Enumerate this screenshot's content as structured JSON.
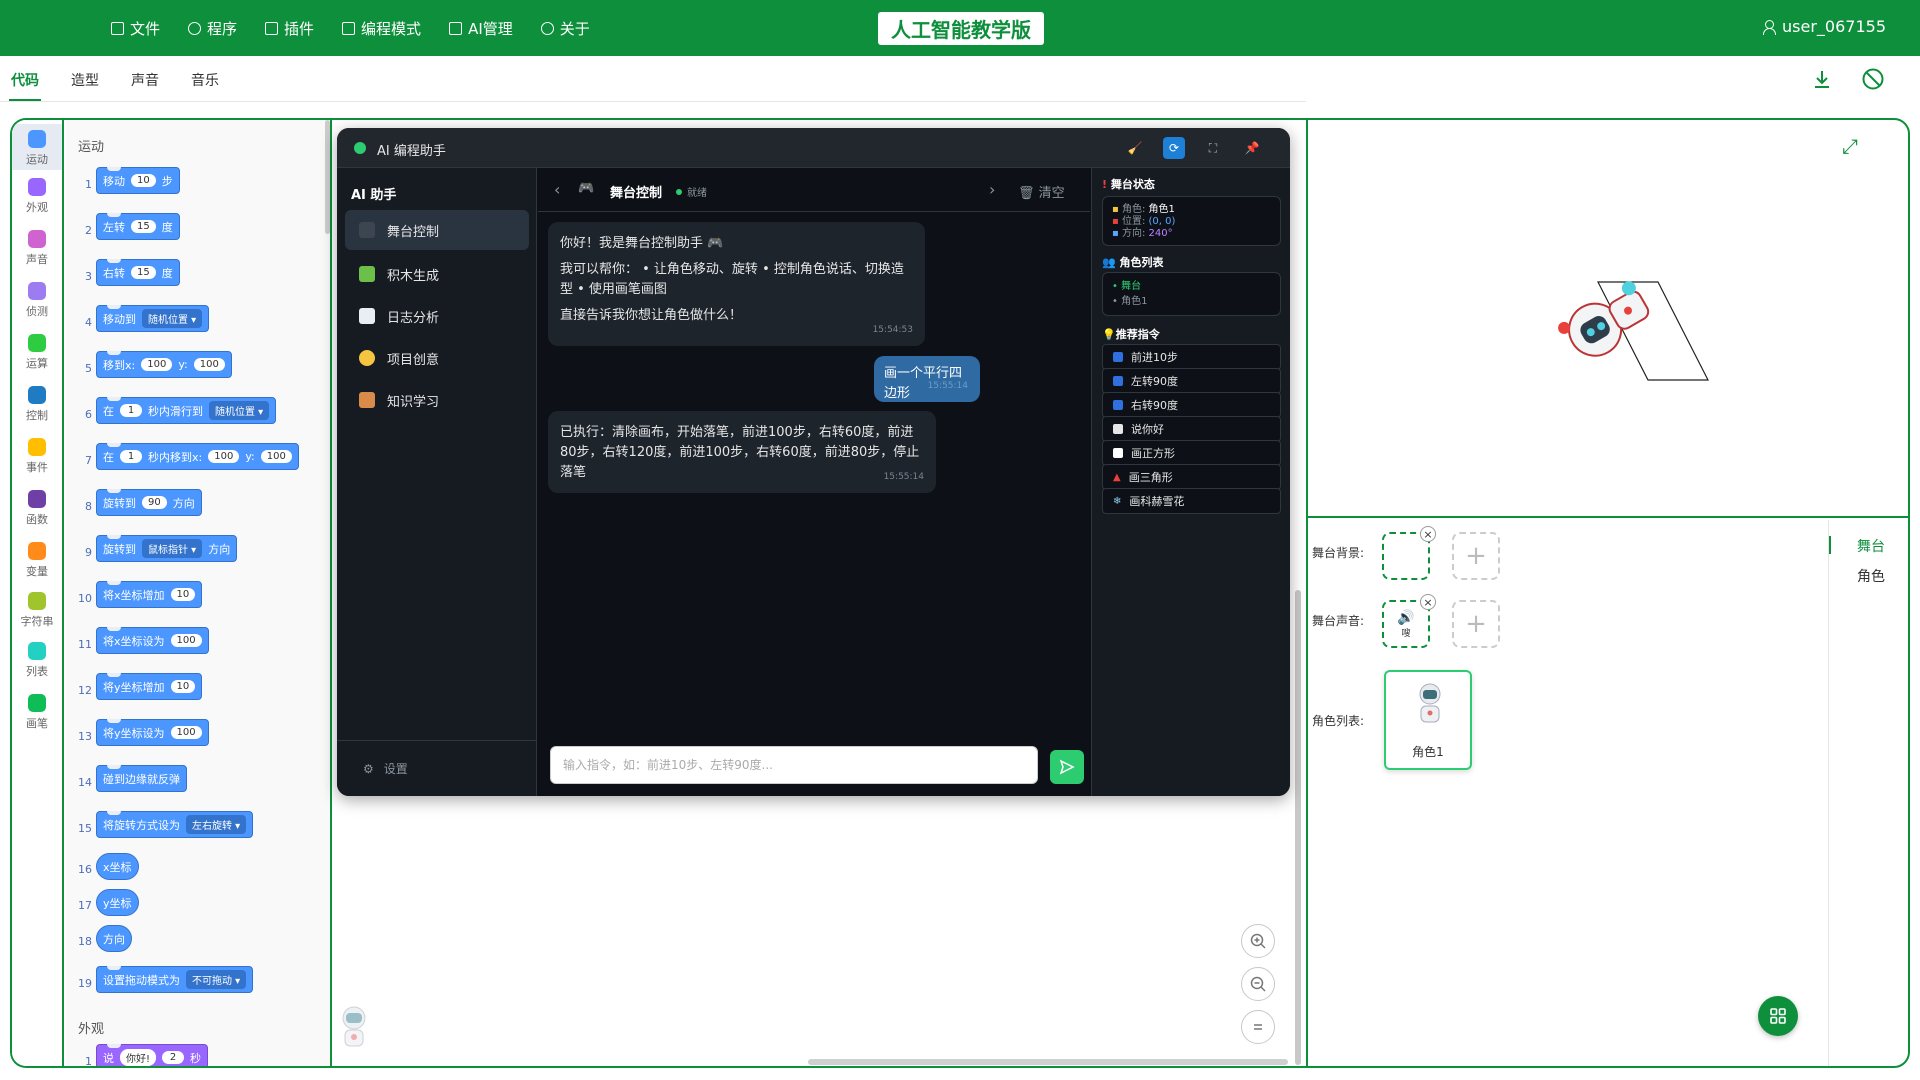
{
  "menu": {
    "items": [
      "文件",
      "程序",
      "插件",
      "编程模式",
      "AI管理",
      "关于"
    ]
  },
  "app_title": "人工智能教学版",
  "user": {
    "name": "user_067155"
  },
  "tabs": [
    "代码",
    "造型",
    "声音",
    "音乐"
  ],
  "categories": [
    {
      "label": "运动",
      "color": "#4c97ff"
    },
    {
      "label": "外观",
      "color": "#9966ff"
    },
    {
      "label": "声音",
      "color": "#cf63cf"
    },
    {
      "label": "侦测",
      "color": "#9c7cf0"
    },
    {
      "label": "运算",
      "color": "#2ecc40"
    },
    {
      "label": "控制",
      "color": "#1f7bc2"
    },
    {
      "label": "事件",
      "color": "#ffbf00"
    },
    {
      "label": "函数",
      "color": "#6f3fa5"
    },
    {
      "label": "变量",
      "color": "#ff8c1a"
    },
    {
      "label": "字符串",
      "color": "#a0c42c"
    },
    {
      "label": "列表",
      "color": "#22d1c4"
    },
    {
      "label": "画笔",
      "color": "#0fbd57"
    }
  ],
  "palette": {
    "motion_header": "运动",
    "looks_header": "外观",
    "blocks": [
      {
        "num": "1",
        "text": "移动",
        "in1": "10",
        "text2": "步"
      },
      {
        "num": "2",
        "text": "左转",
        "in1": "15",
        "text2": "度"
      },
      {
        "num": "3",
        "text": "右转",
        "in1": "15",
        "text2": "度"
      },
      {
        "num": "4",
        "text": "移动到",
        "dd": "随机位置 ▾"
      },
      {
        "num": "5",
        "text": "移到x:",
        "in1": "100",
        "text2": "y:",
        "in2": "100"
      },
      {
        "num": "6",
        "text": "在",
        "in1": "1",
        "text2": "秒内滑行到",
        "dd": "随机位置 ▾"
      },
      {
        "num": "7",
        "text": "在",
        "in1": "1",
        "text2": "秒内移到x:",
        "in2": "100",
        "text3": "y:",
        "in3": "100"
      },
      {
        "num": "8",
        "text": "旋转到",
        "in1": "90",
        "text2": "方向"
      },
      {
        "num": "9",
        "text": "旋转到",
        "dd": "鼠标指针 ▾",
        "text2": "方向"
      },
      {
        "num": "10",
        "text": "将x坐标增加",
        "in1": "10"
      },
      {
        "num": "11",
        "text": "将x坐标设为",
        "in1": "100"
      },
      {
        "num": "12",
        "text": "将y坐标增加",
        "in1": "10"
      },
      {
        "num": "13",
        "text": "将y坐标设为",
        "in1": "100"
      },
      {
        "num": "14",
        "text": "碰到边缘就反弹"
      },
      {
        "num": "15",
        "text": "将旋转方式设为",
        "dd": "左右旋转 ▾"
      },
      {
        "num": "16",
        "text": "x坐标"
      },
      {
        "num": "17",
        "text": "y坐标"
      },
      {
        "num": "18",
        "text": "方向"
      },
      {
        "num": "19",
        "text": "设置拖动模式为",
        "dd": "不可拖动 ▾"
      },
      {
        "num": "1",
        "text": "说",
        "in1": "你好!",
        "in2": "2",
        "text3": "秒"
      }
    ]
  },
  "chat": {
    "title": "AI 编程助手",
    "sidebar_title": "AI 助手",
    "sidebar_items": [
      "舞台控制",
      "积木生成",
      "日志分析",
      "项目创意",
      "知识学习"
    ],
    "settings": "设置",
    "main_title": "舞台控制",
    "main_status": "就绪",
    "clear": "清空",
    "msg1": {
      "line1": "你好！我是舞台控制助手 🎮",
      "line2": "我可以帮你： • 让角色移动、旋转 • 控制角色说话、切换造型 • 使用画笔画图",
      "line3": "直接告诉我你想让角色做什么！",
      "time": "15:54:53"
    },
    "msg2": {
      "text": "画一个平行四边形",
      "time": "15:55:14"
    },
    "msg3": {
      "text": "已执行：清除画布，开始落笔，前进100步，右转60度，前进80步，右转120度，前进100步，右转60度，前进80步，停止落笔",
      "time": "15:55:14"
    },
    "input_placeholder": "输入指令，如：前进10步、左转90度...",
    "stage_status_title": "舞台状态",
    "stage_role_label": "角色:",
    "stage_role": "角色1",
    "stage_pos_label": "位置:",
    "stage_pos": "(0, 0)",
    "stage_dir_label": "方向:",
    "stage_dir": "240°",
    "role_list_title": "角色列表",
    "role_list": [
      "舞台",
      "角色1"
    ],
    "commands_title": "推荐指令",
    "commands": [
      {
        "label": "前进10步",
        "color": "#2f6fe0"
      },
      {
        "label": "左转90度",
        "color": "#2f6fe0"
      },
      {
        "label": "右转90度",
        "color": "#2f6fe0"
      },
      {
        "label": "说你好",
        "color": "#e6e6e6"
      },
      {
        "label": "画正方形",
        "color": "#ffffff"
      },
      {
        "label": "画三角形",
        "color": "#e8413c"
      },
      {
        "label": "画科赫雪花",
        "color": "#8ecae6"
      }
    ]
  },
  "stage_panel": {
    "bg_label": "舞台背景:",
    "sound_label": "舞台声音:",
    "sound_slot_text": "嗖",
    "roles_label": "角色列表:",
    "role_card": "角色1",
    "side_tabs": [
      "舞台",
      "角色"
    ]
  },
  "colors": {
    "brand": "#0e8f3c",
    "accent": "#2ecc71"
  }
}
